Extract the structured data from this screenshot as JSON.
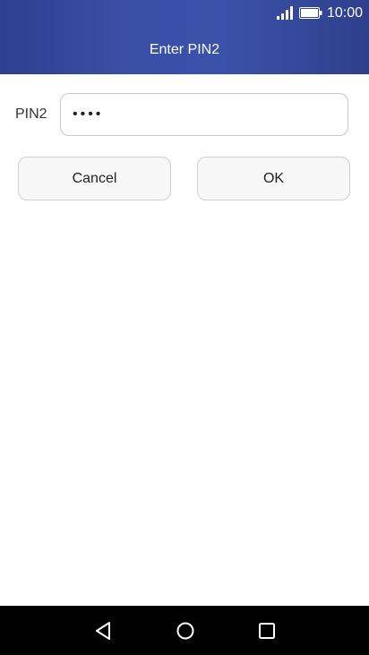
{
  "status_bar": {
    "time": "10:00",
    "signal_icon": "signal-icon",
    "battery_icon": "battery-icon"
  },
  "header": {
    "title": "Enter PIN2"
  },
  "form": {
    "pin_label": "PIN2",
    "pin_value": "••••"
  },
  "buttons": {
    "cancel_label": "Cancel",
    "ok_label": "OK"
  },
  "nav_bar": {
    "back_icon": "back-icon",
    "home_icon": "home-icon",
    "recent_apps_icon": "recent-apps-icon"
  },
  "colors": {
    "header_gradient_start": "#2d3f8f",
    "header_gradient_mid": "#3b52aa",
    "nav_bar": "#000000",
    "button_bg": "#f7f7f7",
    "field_border": "#c9c9c9"
  }
}
